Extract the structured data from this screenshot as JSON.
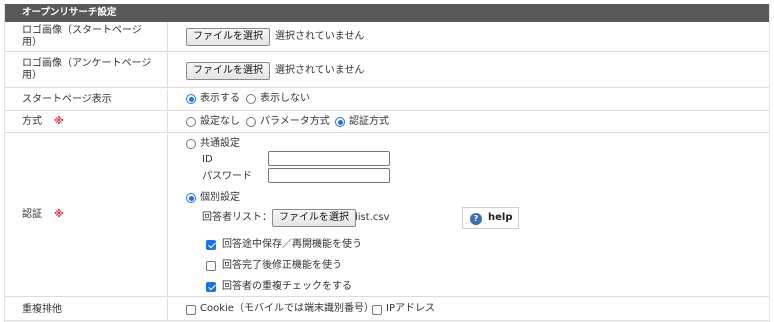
{
  "section_title": "オープンリサーチ設定",
  "rows": {
    "logo_start": {
      "label_line1": "ロゴ画像（スタートページ",
      "label_line2": "用）",
      "button": "ファイルを選択",
      "status": "選択されていません"
    },
    "logo_survey": {
      "label_line1": "ロゴ画像（アンケートページ",
      "label_line2": "用）",
      "button": "ファイルを選択",
      "status": "選択されていません"
    },
    "start_page": {
      "label": "スタートページ表示",
      "options": [
        "表示する",
        "表示しない"
      ],
      "selected": "表示する"
    },
    "method": {
      "label": "方式",
      "required_mark": "※",
      "options": [
        "設定なし",
        "パラメータ方式",
        "認証方式"
      ],
      "selected": "認証方式"
    },
    "auth": {
      "label": "認証",
      "required_mark": "※",
      "common_label": "共通設定",
      "id_label": "ID",
      "password_label": "パスワード",
      "individual_label": "個別設定",
      "selected": "個別設定",
      "respondent_list_label": "回答者リスト：",
      "button": "ファイルを選択",
      "file_name": "list.csv",
      "help_label": "help",
      "checks": [
        {
          "label": "回答途中保存／再開機能を使う",
          "checked": true
        },
        {
          "label": "回答完了後修正機能を使う",
          "checked": false
        },
        {
          "label": "回答者の重複チェックをする",
          "checked": true
        }
      ]
    },
    "dedupe": {
      "label": "重複排他",
      "options": [
        {
          "label": "Cookie（モバイルでは端末識別番号）",
          "checked": false
        },
        {
          "label": "IPアドレス",
          "checked": false
        }
      ]
    }
  },
  "colors": {
    "header_bg": "#595959",
    "accent": "#1a73e8",
    "required": "#e0303a"
  },
  "icons": {
    "help": "question-circle-icon"
  }
}
